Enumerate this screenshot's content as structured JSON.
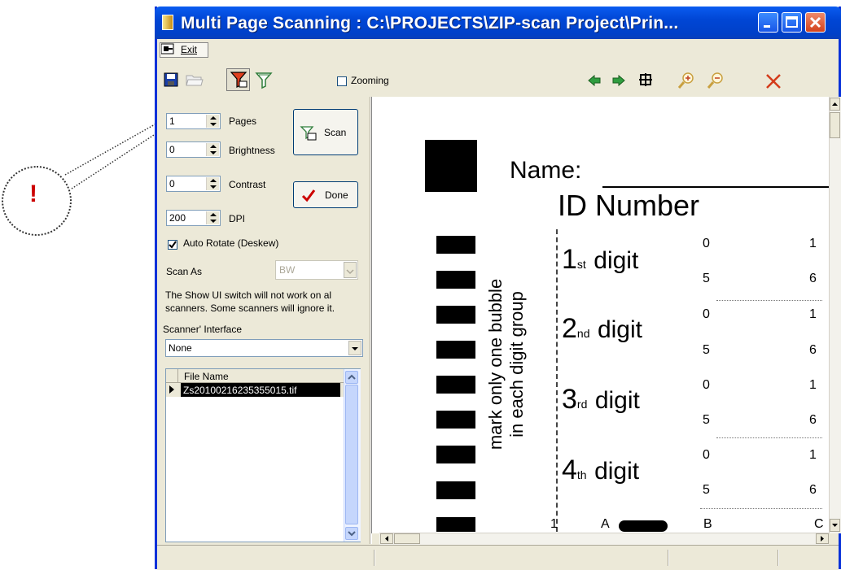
{
  "window": {
    "title": "Multi Page Scanning  :  C:\\PROJECTS\\ZIP-scan Project\\Prin..."
  },
  "menu": {
    "exit_label": "Exit"
  },
  "toolbar": {
    "zooming_label": "Zooming",
    "zooming_checked": false
  },
  "callout": {
    "mark": "!"
  },
  "settings": {
    "pages_value": "1",
    "pages_label": "Pages",
    "brightness_value": "0",
    "brightness_label": "Brightness",
    "contrast_value": "0",
    "contrast_label": "Contrast",
    "dpi_value": "200",
    "dpi_label": "DPI",
    "auto_rotate_label": "Auto Rotate (Deskew)",
    "auto_rotate_checked": true,
    "scan_as_label": "Scan As",
    "scan_as_value": "BW",
    "note_line1": "The Show UI switch will not work on al",
    "note_line2": "scanners. Some scanners will ignore it.",
    "interface_label": "Scanner' Interface",
    "interface_value": "None"
  },
  "buttons": {
    "scan_label": "Scan",
    "done_label": "Done"
  },
  "file_list": {
    "header": "File Name",
    "rows": [
      "Zs20100216235355015.tif"
    ]
  },
  "document": {
    "name_label": "Name:",
    "id_title": "ID Number",
    "vertical_line1": "mark only one bubble",
    "vertical_line2": "in each digit group",
    "digits": [
      {
        "num": "1",
        "suffix": "st",
        "word": "digit",
        "top": "0",
        "top_right": "1",
        "bottom": "5",
        "bottom_right": "6"
      },
      {
        "num": "2",
        "suffix": "nd",
        "word": "digit",
        "top": "0",
        "top_right": "1",
        "bottom": "5",
        "bottom_right": "6"
      },
      {
        "num": "3",
        "suffix": "rd",
        "word": "digit",
        "top": "0",
        "top_right": "1",
        "bottom": "5",
        "bottom_right": "6"
      },
      {
        "num": "4",
        "suffix": "th",
        "word": "digit",
        "top": "0",
        "top_right": "1",
        "bottom": "5",
        "bottom_right": "6"
      }
    ],
    "bottom_row": [
      "1",
      "A",
      "B",
      "C"
    ]
  },
  "colors": {
    "title_bar": "#0046d5",
    "callout_mark": "#cc0000",
    "done_check": "#cc0000",
    "close_x": "#d43b1a"
  }
}
